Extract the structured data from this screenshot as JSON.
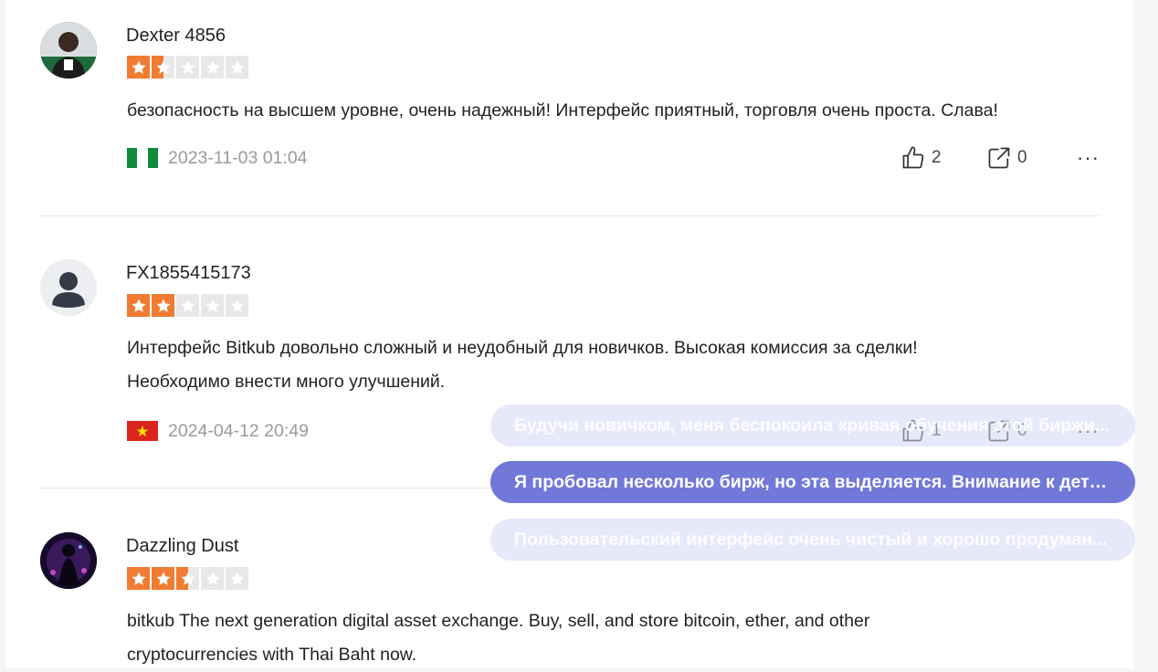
{
  "reviews": [
    {
      "username": "Dexter 4856",
      "rating": 1.5,
      "text": "безопасность на высшем уровне, очень надежный! Интерфейс приятный, торговля очень проста. Слава!",
      "flag": "nigeria-flag",
      "date": "2023-11-03 01:04",
      "likes": "2",
      "shares": "0"
    },
    {
      "username": "FX1855415173",
      "rating": 2,
      "text_line1": "Интерфейс Bitkub довольно сложный и неудобный для новичков. Высокая комиссия за сделки!",
      "text_line2": "Необходимо внести много улучшений.",
      "flag": "vietnam-flag",
      "date": "2024-04-12 20:49",
      "likes": "1",
      "shares": "0"
    },
    {
      "username": "Dazzling Dust",
      "rating": 2.5,
      "text_line1": "bitkub The next generation digital asset exchange. Buy, sell, and store bitcoin, ether, and other",
      "text_line2": "cryptocurrencies with Thai Baht now."
    }
  ],
  "suggestions": [
    "Будучи новичком, меня беспокоила кривая обучения этой биржи...",
    "Я пробовал несколько бирж, но эта выделяется. Внимание к деталям...",
    "Пользовательский интерфейс очень чистый и хорошо продуман..."
  ],
  "more_label": "···",
  "colors": {
    "star_filled": "#f07c33",
    "star_empty": "#e8e8e8",
    "chip_active": "#7178d8",
    "chip_faded": "#d3d7f7"
  }
}
